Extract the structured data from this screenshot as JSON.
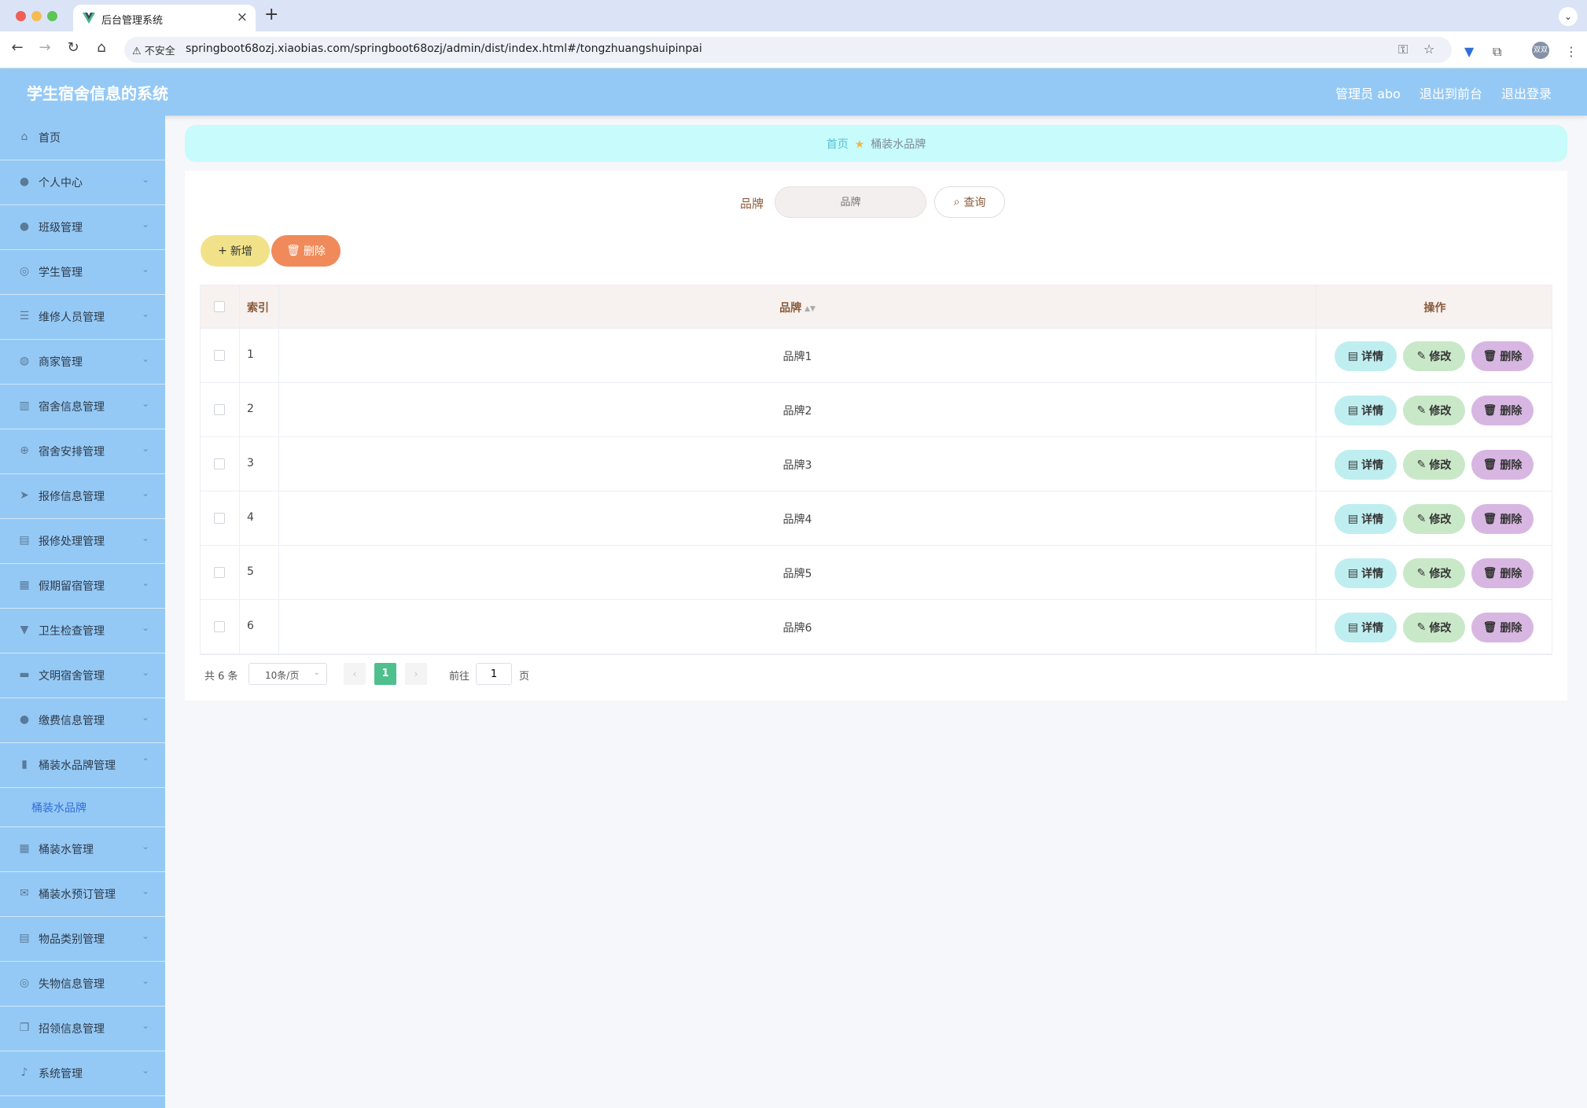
{
  "browser": {
    "tab_title": "后台管理系统",
    "security_label": "不安全",
    "url": "springboot68ozj.xiaobias.com/springboot68ozj/admin/dist/index.html#/tongzhuangshuipinpai",
    "profile_label": "双双"
  },
  "header": {
    "title": "学生宿舍信息的系统",
    "user": "管理员 abo",
    "to_front": "退出到前台",
    "logout": "退出登录"
  },
  "sidebar": {
    "items": [
      {
        "label": "首页",
        "icon": "home-icon"
      },
      {
        "label": "个人中心",
        "icon": "user-icon"
      },
      {
        "label": "班级管理",
        "icon": "user-icon"
      },
      {
        "label": "学生管理",
        "icon": "compass-icon"
      },
      {
        "label": "维修人员管理",
        "icon": "sliders-icon"
      },
      {
        "label": "商家管理",
        "icon": "globe-icon"
      },
      {
        "label": "宿舍信息管理",
        "icon": "bar-icon"
      },
      {
        "label": "宿舍安排管理",
        "icon": "target-icon"
      },
      {
        "label": "报修信息管理",
        "icon": "send-icon"
      },
      {
        "label": "报修处理管理",
        "icon": "clipboard-icon"
      },
      {
        "label": "假期留宿管理",
        "icon": "grid-icon"
      },
      {
        "label": "卫生检查管理",
        "icon": "brush-icon"
      },
      {
        "label": "文明宿舍管理",
        "icon": "stamp-icon"
      },
      {
        "label": "缴费信息管理",
        "icon": "user-icon"
      },
      {
        "label": "桶装水品牌管理",
        "icon": "chart-icon"
      }
    ],
    "sub_item": "桶装水品牌",
    "items_after": [
      {
        "label": "桶装水管理",
        "icon": "grid-icon"
      },
      {
        "label": "桶装水预订管理",
        "icon": "mail-icon"
      },
      {
        "label": "物品类别管理",
        "icon": "clipboard-icon"
      },
      {
        "label": "失物信息管理",
        "icon": "compass-icon"
      },
      {
        "label": "招领信息管理",
        "icon": "copy-icon"
      },
      {
        "label": "系统管理",
        "icon": "mic-icon"
      }
    ]
  },
  "breadcrumb": {
    "home": "首页",
    "current": "桶装水品牌"
  },
  "search": {
    "label": "品牌",
    "placeholder": "品牌",
    "button": "查询"
  },
  "actions": {
    "add": "新增",
    "delete": "删除"
  },
  "table": {
    "headers": {
      "index": "索引",
      "brand": "品牌",
      "ops": "操作"
    },
    "rows": [
      {
        "index": "1",
        "brand": "品牌1"
      },
      {
        "index": "2",
        "brand": "品牌2"
      },
      {
        "index": "3",
        "brand": "品牌3"
      },
      {
        "index": "4",
        "brand": "品牌4"
      },
      {
        "index": "5",
        "brand": "品牌5"
      },
      {
        "index": "6",
        "brand": "品牌6"
      }
    ],
    "op_labels": {
      "detail": "详情",
      "edit": "修改",
      "delete": "删除"
    }
  },
  "pagination": {
    "total": "共 6 条",
    "page_size": "10条/页",
    "current_page": "1",
    "goto_label": "前往",
    "goto_value": "1",
    "page_suffix": "页"
  },
  "colors": {
    "header_bg": "#95c9f5",
    "breadcrumb_bg": "#c8fbfb",
    "add_btn": "#f1e28a",
    "delete_btn": "#f08a5a",
    "pager_active": "#4fc08d"
  }
}
